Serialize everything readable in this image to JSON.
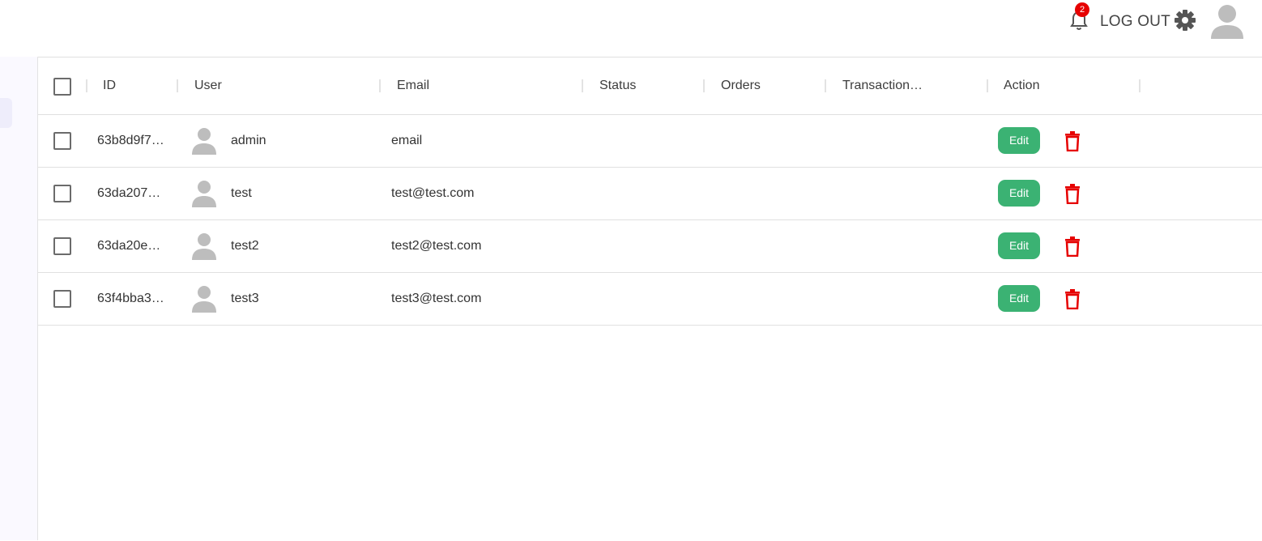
{
  "topbar": {
    "notifications": {
      "icon": "bell-icon",
      "count": "2"
    },
    "logout_label": "LOG OUT",
    "settings_icon": "gear-icon",
    "avatar_icon": "user-avatar-icon"
  },
  "colors": {
    "accent_green": "#3bb273",
    "danger_red": "#e60000",
    "sidebar_bg": "#faf9ff"
  },
  "grid": {
    "columns": [
      {
        "key": "id",
        "label": "ID"
      },
      {
        "key": "user",
        "label": "User"
      },
      {
        "key": "email",
        "label": "Email"
      },
      {
        "key": "status",
        "label": "Status"
      },
      {
        "key": "orders",
        "label": "Orders"
      },
      {
        "key": "transactions",
        "label": "Transaction…"
      },
      {
        "key": "action",
        "label": "Action"
      }
    ],
    "rows": [
      {
        "id": "63b8d9f7…",
        "user": "admin",
        "email": "email",
        "status": "",
        "orders": "",
        "transactions": "",
        "edit_label": "Edit"
      },
      {
        "id": "63da207…",
        "user": "test",
        "email": "test@test.com",
        "status": "",
        "orders": "",
        "transactions": "",
        "edit_label": "Edit"
      },
      {
        "id": "63da20e…",
        "user": "test2",
        "email": "test2@test.com",
        "status": "",
        "orders": "",
        "transactions": "",
        "edit_label": "Edit"
      },
      {
        "id": "63f4bba3…",
        "user": "test3",
        "email": "test3@test.com",
        "status": "",
        "orders": "",
        "transactions": "",
        "edit_label": "Edit"
      }
    ]
  }
}
